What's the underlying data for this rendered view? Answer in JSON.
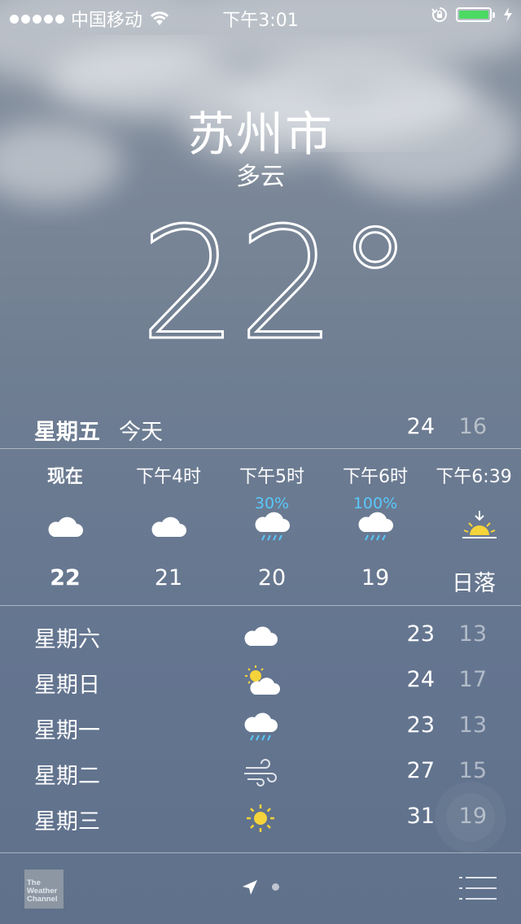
{
  "status_bar": {
    "carrier": "中国移动",
    "time": "下午3:01",
    "battery_level": 1.0,
    "icons": [
      "signal-dots-icon",
      "wifi-icon",
      "rotation-lock-icon",
      "battery-icon",
      "charging-bolt-icon"
    ]
  },
  "header": {
    "city": "苏州市",
    "condition": "多云",
    "temperature": "22°"
  },
  "today": {
    "day": "星期五",
    "label": "今天",
    "high": "24",
    "low": "16"
  },
  "hourly": [
    {
      "time": "现在",
      "precip": "",
      "icon": "cloud-icon",
      "value": "22"
    },
    {
      "time": "下午4时",
      "precip": "",
      "icon": "cloud-icon",
      "value": "21"
    },
    {
      "time": "下午5时",
      "precip": "30%",
      "icon": "rain-cloud-icon",
      "value": "20"
    },
    {
      "time": "下午6时",
      "precip": "100%",
      "icon": "rain-cloud-icon",
      "value": "19"
    },
    {
      "time": "下午6:39",
      "precip": "",
      "icon": "sunset-icon",
      "value": "日落"
    }
  ],
  "daily": [
    {
      "day": "星期六",
      "icon": "cloud-icon",
      "high": "23",
      "low": "13"
    },
    {
      "day": "星期日",
      "icon": "partly-sunny-icon",
      "high": "24",
      "low": "17"
    },
    {
      "day": "星期一",
      "icon": "rain-cloud-icon",
      "high": "23",
      "low": "13"
    },
    {
      "day": "星期二",
      "icon": "wind-icon",
      "high": "27",
      "low": "15"
    },
    {
      "day": "星期三",
      "icon": "sun-icon",
      "high": "31",
      "low": "19"
    }
  ],
  "footer": {
    "weather_channel_logo": "The Weather Channel",
    "icons": [
      "location-arrow-icon",
      "page-dot-icon",
      "list-icon"
    ]
  },
  "colors": {
    "precip_blue": "#5ac8fa",
    "sun_yellow": "#f5d33a",
    "battery_green": "#4cd964"
  }
}
